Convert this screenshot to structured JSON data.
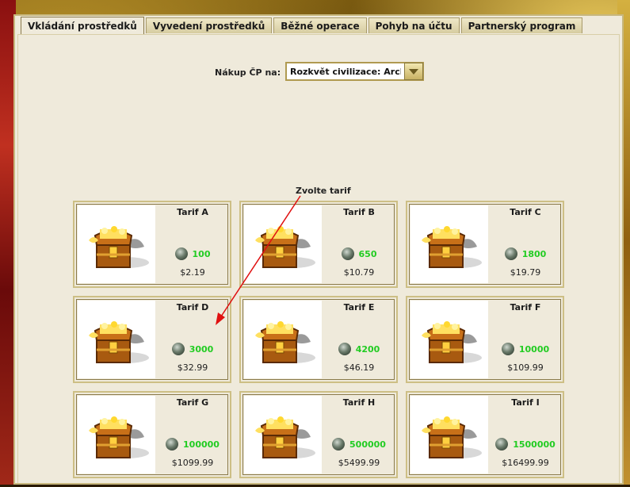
{
  "tabs": [
    {
      "label": "Vkládání prostředků",
      "active": true
    },
    {
      "label": "Vyvedení prostředků",
      "active": false
    },
    {
      "label": "Běžné operace",
      "active": false
    },
    {
      "label": "Pohyb na účtu",
      "active": false
    },
    {
      "label": "Partnerský program",
      "active": false
    }
  ],
  "purchase": {
    "label": "Nákup ČP na:",
    "selected": "Rozkvět civilizace: Archo"
  },
  "choose_label": "Zvolte tarif",
  "tariffs": [
    {
      "title": "Tarif A",
      "amount": "100",
      "price": "$2.19"
    },
    {
      "title": "Tarif B",
      "amount": "650",
      "price": "$10.79"
    },
    {
      "title": "Tarif C",
      "amount": "1800",
      "price": "$19.79"
    },
    {
      "title": "Tarif D",
      "amount": "3000",
      "price": "$32.99"
    },
    {
      "title": "Tarif E",
      "amount": "4200",
      "price": "$46.19"
    },
    {
      "title": "Tarif F",
      "amount": "10000",
      "price": "$109.99"
    },
    {
      "title": "Tarif G",
      "amount": "100000",
      "price": "$1099.99"
    },
    {
      "title": "Tarif H",
      "amount": "500000",
      "price": "$5499.99"
    },
    {
      "title": "Tarif I",
      "amount": "1500000",
      "price": "$16499.99"
    }
  ],
  "colors": {
    "panel_bg": "#efeadb",
    "amount_green": "#22cc22",
    "arrow_red": "#e01010",
    "border_gold": "#cdbf85"
  },
  "icons": {
    "coin": "coin-icon",
    "chest": "treasure-chest-icon",
    "dropdown": "chevron-down-icon"
  }
}
